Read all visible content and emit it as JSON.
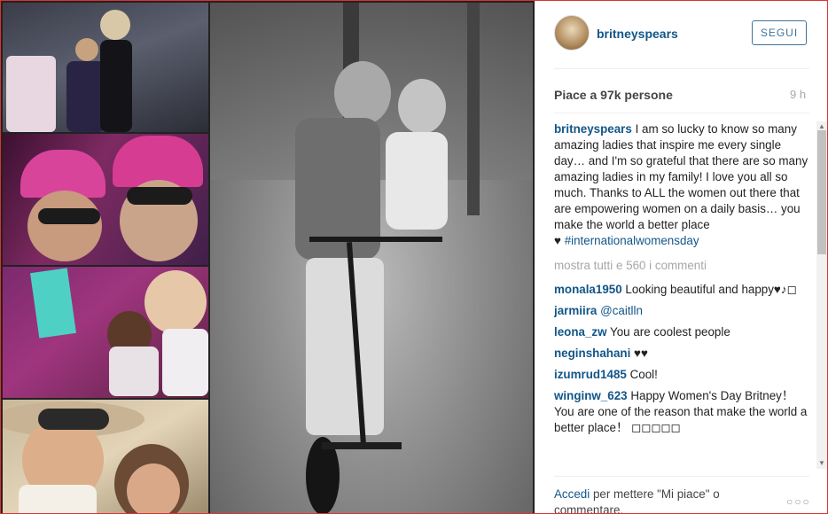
{
  "post": {
    "username": "britneyspears",
    "follow_label": "SEGUI",
    "likes": "Piace a 97k persone",
    "time": "9 h"
  },
  "icons": {
    "avatar": "profile-photo",
    "more": "ellipsis-icon"
  },
  "colors": {
    "link": "#125688",
    "button_border": "#3f729b",
    "muted": "#a5a7aa"
  },
  "caption": {
    "user": "britneyspears",
    "text": "I am so lucky to know so many amazing ladies that inspire me every single day… and I'm so grateful that there are so many amazing ladies in my family! I love you all so much. Thanks to ALL the women out there that are empowering women on a daily basis… you make the world a better place",
    "heart": "♥",
    "hashtag": "#internationalwomensday"
  },
  "view_all": "mostra tutti e 560 i commenti",
  "comments": [
    {
      "user": "monala1950",
      "text": "Looking beautiful and happy♥♪◻"
    },
    {
      "user": "jarmiira",
      "text": "@caitlln"
    },
    {
      "user": "leona_zw",
      "text": "You are coolest people"
    },
    {
      "user": "neginshahani",
      "text": "♥♥"
    },
    {
      "user": "izumrud1485",
      "text": "Cool!"
    },
    {
      "user": "winginw_623",
      "text": "Happy Women's Day Britney！ You are one of the reason that make the world a better place！ ◻◻◻◻◻"
    }
  ],
  "footer": {
    "login": "Accedi",
    "rest": "per mettere \"Mi piace\" o commentare.",
    "more": "○○○"
  }
}
